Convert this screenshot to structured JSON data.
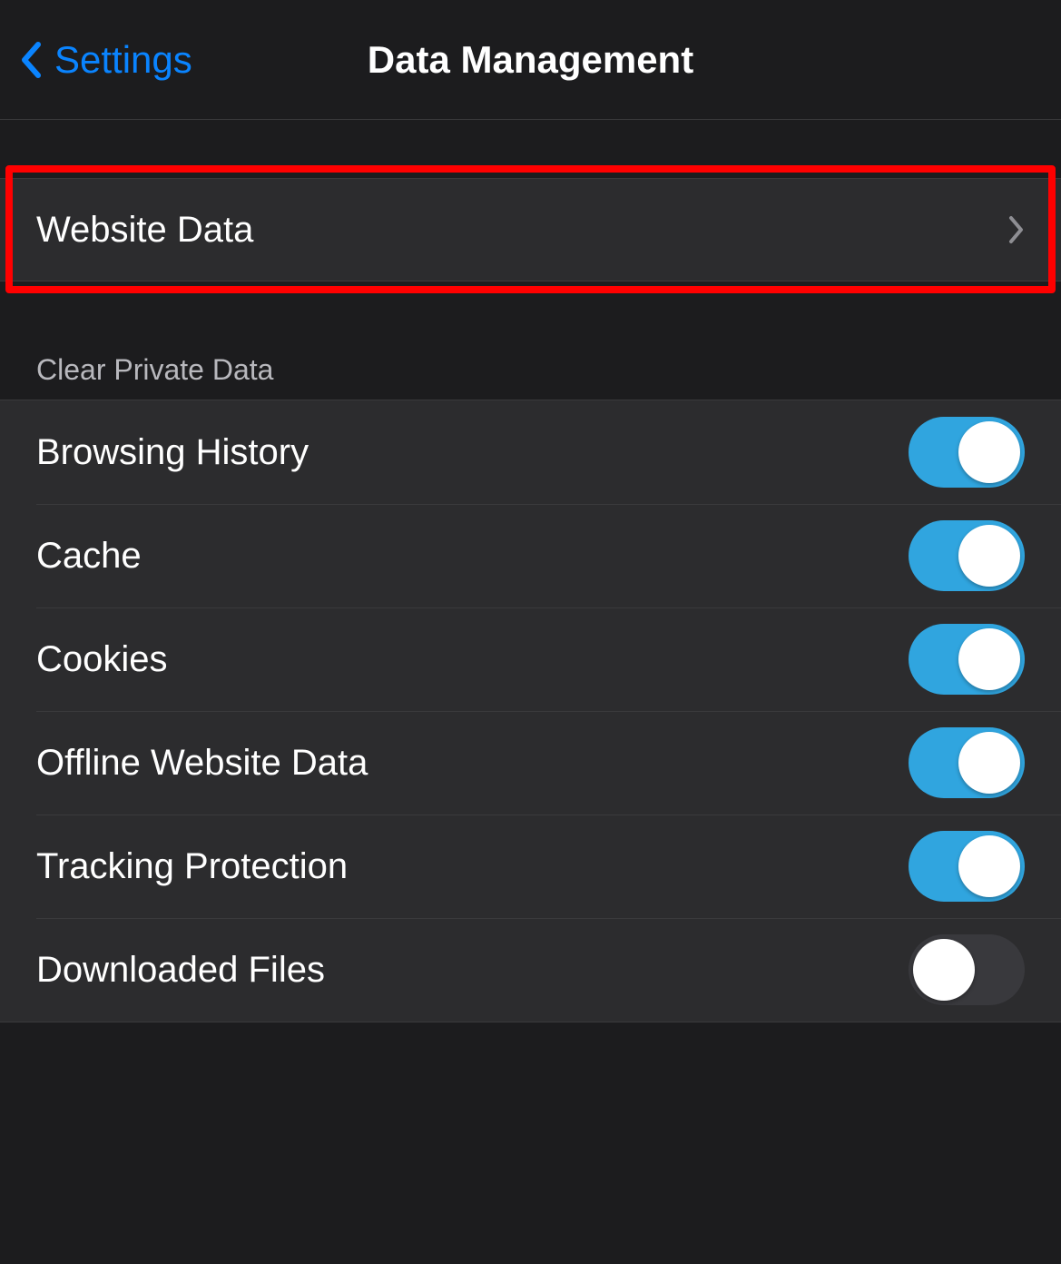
{
  "nav": {
    "back_label": "Settings",
    "title": "Data Management"
  },
  "website_data": {
    "label": "Website Data"
  },
  "clear_section": {
    "header": "Clear Private Data",
    "items": [
      {
        "label": "Browsing History",
        "on": true
      },
      {
        "label": "Cache",
        "on": true
      },
      {
        "label": "Cookies",
        "on": true
      },
      {
        "label": "Offline Website Data",
        "on": true
      },
      {
        "label": "Tracking Protection",
        "on": true
      },
      {
        "label": "Downloaded Files",
        "on": false
      }
    ]
  },
  "highlight": {
    "target": "website-data-row",
    "color": "#ff0000"
  }
}
